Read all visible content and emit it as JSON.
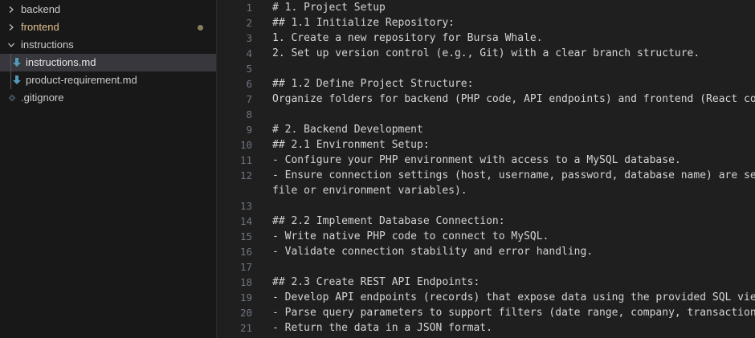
{
  "explorer": {
    "items": [
      {
        "label": "backend",
        "type": "folder",
        "expanded": false
      },
      {
        "label": "frontend",
        "type": "folder",
        "expanded": false,
        "modified": true
      },
      {
        "label": "instructions",
        "type": "folder",
        "expanded": true
      },
      {
        "label": "instructions.md",
        "type": "file",
        "icon": "markdown-icon",
        "selected": true
      },
      {
        "label": "product-requirement.md",
        "type": "file",
        "icon": "markdown-icon"
      },
      {
        "label": ".gitignore",
        "type": "file",
        "icon": "git-icon"
      }
    ]
  },
  "editor": {
    "lines": [
      {
        "n": "1",
        "text": "# 1. Project Setup"
      },
      {
        "n": "2",
        "text": "## 1.1 Initialize Repository:"
      },
      {
        "n": "3",
        "text": "1. Create a new repository for Bursa Whale."
      },
      {
        "n": "4",
        "text": "2. Set up version control (e.g., Git) with a clear branch structure."
      },
      {
        "n": "5",
        "text": ""
      },
      {
        "n": "6",
        "text": "## 1.2 Define Project Structure:"
      },
      {
        "n": "7",
        "text": "Organize folders for backend (PHP code, API endpoints) and frontend (React com"
      },
      {
        "n": "8",
        "text": ""
      },
      {
        "n": "9",
        "text": "# 2. Backend Development"
      },
      {
        "n": "10",
        "text": "## 2.1 Environment Setup:"
      },
      {
        "n": "11",
        "text": "- Configure your PHP environment with access to a MySQL database."
      },
      {
        "n": "12",
        "text": "- Ensure connection settings (host, username, password, database name) are sec"
      },
      {
        "n": "",
        "text": "file or environment variables)."
      },
      {
        "n": "13",
        "text": ""
      },
      {
        "n": "14",
        "text": "## 2.2 Implement Database Connection:"
      },
      {
        "n": "15",
        "text": "- Write native PHP code to connect to MySQL."
      },
      {
        "n": "16",
        "text": "- Validate connection stability and error handling."
      },
      {
        "n": "17",
        "text": ""
      },
      {
        "n": "18",
        "text": "## 2.3 Create REST API Endpoints:"
      },
      {
        "n": "19",
        "text": "- Develop API endpoints (records) that expose data using the provided SQL view"
      },
      {
        "n": "20",
        "text": "- Parse query parameters to support filters (date range, company, transaction"
      },
      {
        "n": "21",
        "text": "- Return the data in a JSON format."
      }
    ]
  },
  "colors": {
    "sidebar_bg": "#181818",
    "editor_bg": "#1f1f1f",
    "selected_bg": "#37373d",
    "modified_text": "#e2c08d",
    "markdown_icon": "#519aba"
  }
}
